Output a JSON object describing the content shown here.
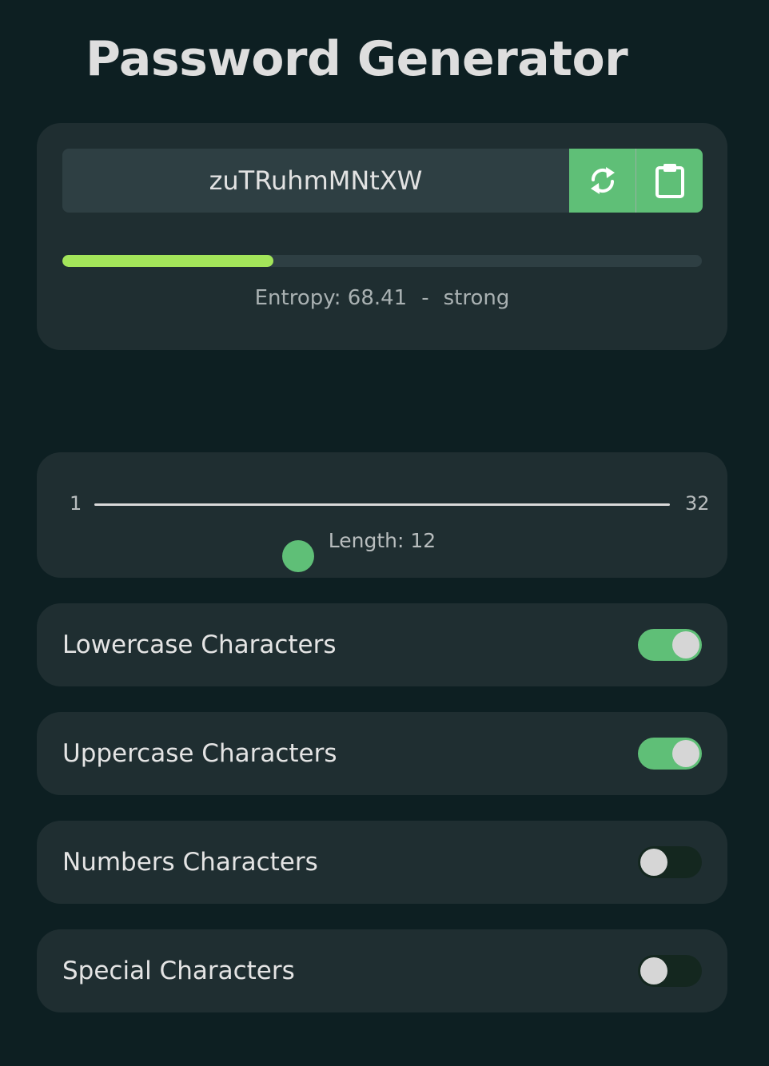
{
  "header": {
    "title": "Password Generator"
  },
  "generator": {
    "password": "zuTRuhmMNtXW",
    "regenerate_icon": "refresh-icon",
    "copy_icon": "clipboard-icon",
    "strength_fraction": 0.33,
    "strength_color": "#a3e55a",
    "entropy_text": "Entropy: 68.41",
    "separator": "-",
    "strength_label": "strong"
  },
  "length": {
    "min": "1",
    "max": "32",
    "value": 12,
    "label": "Length: 12"
  },
  "options": [
    {
      "label": "Lowercase Characters",
      "enabled": true
    },
    {
      "label": "Uppercase Characters",
      "enabled": true
    },
    {
      "label": "Numbers Characters",
      "enabled": false
    },
    {
      "label": "Special Characters",
      "enabled": false
    }
  ],
  "colors": {
    "background": "#0d1f22",
    "card": "#1f2e31",
    "accent": "#5fbf77",
    "toggle_off": "#14271f"
  }
}
